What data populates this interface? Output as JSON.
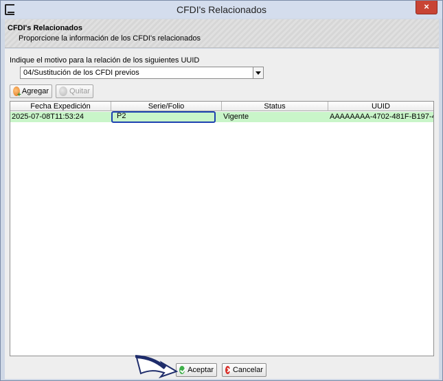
{
  "window": {
    "title": "CFDI's Relacionados",
    "close_label": "×"
  },
  "banner": {
    "title": "CFDI's Relacionados",
    "subtitle": "Proporcione la información de los CFDI's relacionados"
  },
  "motivo": {
    "label": "Indique el motivo para la relación de los siguientes UUID",
    "selected": "04/Sustitución de los CFDI previos"
  },
  "toolbar": {
    "add_label": "Agregar",
    "remove_label": "Quitar"
  },
  "table": {
    "columns": [
      "Fecha Expedición",
      "Serie/Folio",
      "Status",
      "UUID"
    ],
    "rows": [
      [
        "2025-07-08T11:53:24",
        "P2",
        "Vigente",
        "AAAAAAAA-4702-481F-B197-44..."
      ]
    ]
  },
  "footer": {
    "accept_label": "Aceptar",
    "cancel_label": "Cancelar"
  },
  "colors": {
    "selected_row": "#c9f5c9",
    "edit_border": "#1c3fb0",
    "close_button": "#c84435"
  }
}
